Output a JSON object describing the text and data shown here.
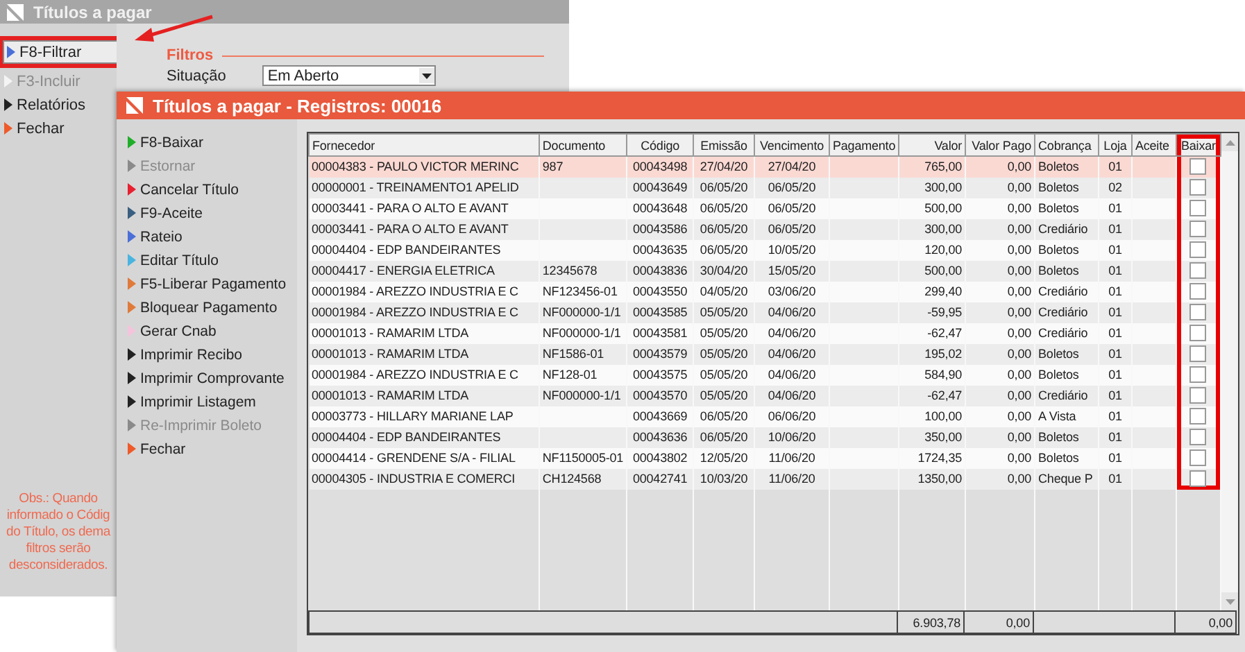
{
  "back_window": {
    "title": "Títulos a pagar",
    "menu": [
      {
        "label": "F8-Filtrar",
        "color": "#4a6fd8",
        "disabled": false,
        "highlighted": true
      },
      {
        "label": "F3-Incluir",
        "color": "#f4f4f4",
        "disabled": true,
        "highlighted": false
      },
      {
        "label": "Relatórios",
        "color": "#222222",
        "disabled": false,
        "highlighted": false
      },
      {
        "label": "Fechar",
        "color": "#ee5a2a",
        "disabled": false,
        "highlighted": false
      }
    ],
    "filters": {
      "heading": "Filtros",
      "situacao_label": "Situação",
      "situacao_value": "Em Aberto"
    },
    "note_lines": [
      "Obs.: Quando",
      "informado o Códig",
      "do Título, os dema",
      "filtros serão",
      "desconsiderados."
    ]
  },
  "front_window": {
    "title": "Títulos a pagar - Registros: 00016",
    "menu": [
      {
        "label": "F8-Baixar",
        "color": "#1fae2a",
        "disabled": false
      },
      {
        "label": "Estornar",
        "color": "#8a8a8a",
        "disabled": true
      },
      {
        "label": "Cancelar Título",
        "color": "#e82030",
        "disabled": false
      },
      {
        "label": "F9-Aceite",
        "color": "#3a5f80",
        "disabled": false
      },
      {
        "label": "Rateio",
        "color": "#4a6fd8",
        "disabled": false
      },
      {
        "label": "Editar Título",
        "color": "#4ab4e0",
        "disabled": false
      },
      {
        "label": "F5-Liberar Pagamento",
        "color": "#e07a3a",
        "disabled": false
      },
      {
        "label": "Bloquear Pagamento",
        "color": "#e07a3a",
        "disabled": false
      },
      {
        "label": "Gerar Cnab",
        "color": "#f4c4dc",
        "disabled": false
      },
      {
        "label": "Imprimir Recibo",
        "color": "#222222",
        "disabled": false
      },
      {
        "label": "Imprimir Comprovante",
        "color": "#222222",
        "disabled": false
      },
      {
        "label": "Imprimir Listagem",
        "color": "#222222",
        "disabled": false
      },
      {
        "label": "Re-Imprimir Boleto",
        "color": "#8a8a8a",
        "disabled": true
      },
      {
        "label": "Fechar",
        "color": "#ee5a2a",
        "disabled": false
      }
    ],
    "table": {
      "columns": [
        {
          "label": "Fornecedor",
          "highlighted": false
        },
        {
          "label": "Documento",
          "highlighted": false
        },
        {
          "label": "Código",
          "highlighted": false
        },
        {
          "label": "Emissão",
          "highlighted": false
        },
        {
          "label": "Vencimento",
          "highlighted": false
        },
        {
          "label": "Pagamento",
          "highlighted": false
        },
        {
          "label": "Valor",
          "highlighted": false
        },
        {
          "label": "Valor Pago",
          "highlighted": false
        },
        {
          "label": "Cobrança",
          "highlighted": false
        },
        {
          "label": "Loja",
          "highlighted": false
        },
        {
          "label": "Aceite",
          "highlighted": false
        },
        {
          "label": "Baixar",
          "highlighted": true
        }
      ],
      "rows": [
        {
          "cells": [
            "00004383 - PAULO VICTOR MERINC",
            "987",
            "00043498",
            "27/04/20",
            "27/04/20",
            "",
            "765,00",
            "0,00",
            "Boletos",
            "01",
            ""
          ],
          "checked": false,
          "selected": true
        },
        {
          "cells": [
            "00000001 - TREINAMENTO1 APELID",
            "",
            "00043649",
            "06/05/20",
            "06/05/20",
            "",
            "300,00",
            "0,00",
            "Boletos",
            "02",
            ""
          ],
          "checked": false,
          "selected": false
        },
        {
          "cells": [
            "00003441 - PARA O ALTO E AVANT",
            "",
            "00043648",
            "06/05/20",
            "06/05/20",
            "",
            "500,00",
            "0,00",
            "Boletos",
            "01",
            ""
          ],
          "checked": false,
          "selected": false
        },
        {
          "cells": [
            "00003441 - PARA O ALTO E AVANT",
            "",
            "00043586",
            "06/05/20",
            "06/05/20",
            "",
            "300,00",
            "0,00",
            "Crediário",
            "01",
            ""
          ],
          "checked": false,
          "selected": false
        },
        {
          "cells": [
            "00004404 - EDP BANDEIRANTES",
            "",
            "00043635",
            "06/05/20",
            "10/05/20",
            "",
            "120,00",
            "0,00",
            "Boletos",
            "01",
            ""
          ],
          "checked": false,
          "selected": false
        },
        {
          "cells": [
            "00004417 - ENERGIA ELETRICA",
            "12345678",
            "00043836",
            "30/04/20",
            "15/05/20",
            "",
            "500,00",
            "0,00",
            "Boletos",
            "01",
            ""
          ],
          "checked": false,
          "selected": false
        },
        {
          "cells": [
            "00001984 - AREZZO INDUSTRIA E C",
            "NF123456-01",
            "00043550",
            "04/05/20",
            "03/06/20",
            "",
            "299,40",
            "0,00",
            "Crediário",
            "01",
            ""
          ],
          "checked": false,
          "selected": false
        },
        {
          "cells": [
            "00001984 - AREZZO INDUSTRIA E C",
            "NF000000-1/1",
            "00043585",
            "05/05/20",
            "04/06/20",
            "",
            "-59,95",
            "0,00",
            "Crediário",
            "01",
            ""
          ],
          "checked": false,
          "selected": false
        },
        {
          "cells": [
            "00001013 - RAMARIM LTDA",
            "NF000000-1/1",
            "00043581",
            "05/05/20",
            "04/06/20",
            "",
            "-62,47",
            "0,00",
            "Crediário",
            "01",
            ""
          ],
          "checked": false,
          "selected": false
        },
        {
          "cells": [
            "00001013 - RAMARIM LTDA",
            "NF1586-01",
            "00043579",
            "05/05/20",
            "04/06/20",
            "",
            "195,02",
            "0,00",
            "Boletos",
            "01",
            ""
          ],
          "checked": false,
          "selected": false
        },
        {
          "cells": [
            "00001984 - AREZZO INDUSTRIA E C",
            "NF128-01",
            "00043575",
            "05/05/20",
            "04/06/20",
            "",
            "584,90",
            "0,00",
            "Boletos",
            "01",
            ""
          ],
          "checked": false,
          "selected": false
        },
        {
          "cells": [
            "00001013 - RAMARIM LTDA",
            "NF000000-1/1",
            "00043570",
            "05/05/20",
            "04/06/20",
            "",
            "-62,47",
            "0,00",
            "Crediário",
            "01",
            ""
          ],
          "checked": false,
          "selected": false
        },
        {
          "cells": [
            "00003773 - HILLARY MARIANE LAP",
            "",
            "00043669",
            "06/05/20",
            "06/06/20",
            "",
            "100,00",
            "0,00",
            "A Vista",
            "01",
            ""
          ],
          "checked": false,
          "selected": false
        },
        {
          "cells": [
            "00004404 - EDP BANDEIRANTES",
            "",
            "00043636",
            "06/05/20",
            "10/06/20",
            "",
            "350,00",
            "0,00",
            "Boletos",
            "01",
            ""
          ],
          "checked": false,
          "selected": false
        },
        {
          "cells": [
            "00004414 - GRENDENE S/A - FILIAL",
            "NF1150005-01",
            "00043802",
            "12/05/20",
            "11/06/20",
            "",
            "1724,35",
            "0,00",
            "Boletos",
            "01",
            ""
          ],
          "checked": false,
          "selected": false
        },
        {
          "cells": [
            "00004305 - INDUSTRIA E COMERCI",
            "CH124568",
            "00042741",
            "10/03/20",
            "11/06/20",
            "",
            "1350,00",
            "0,00",
            "Cheque P",
            "01",
            ""
          ],
          "checked": false,
          "selected": false
        }
      ],
      "totals": {
        "valor": "6.903,78",
        "valor_pago": "0,00",
        "baixar": "0,00"
      }
    }
  }
}
